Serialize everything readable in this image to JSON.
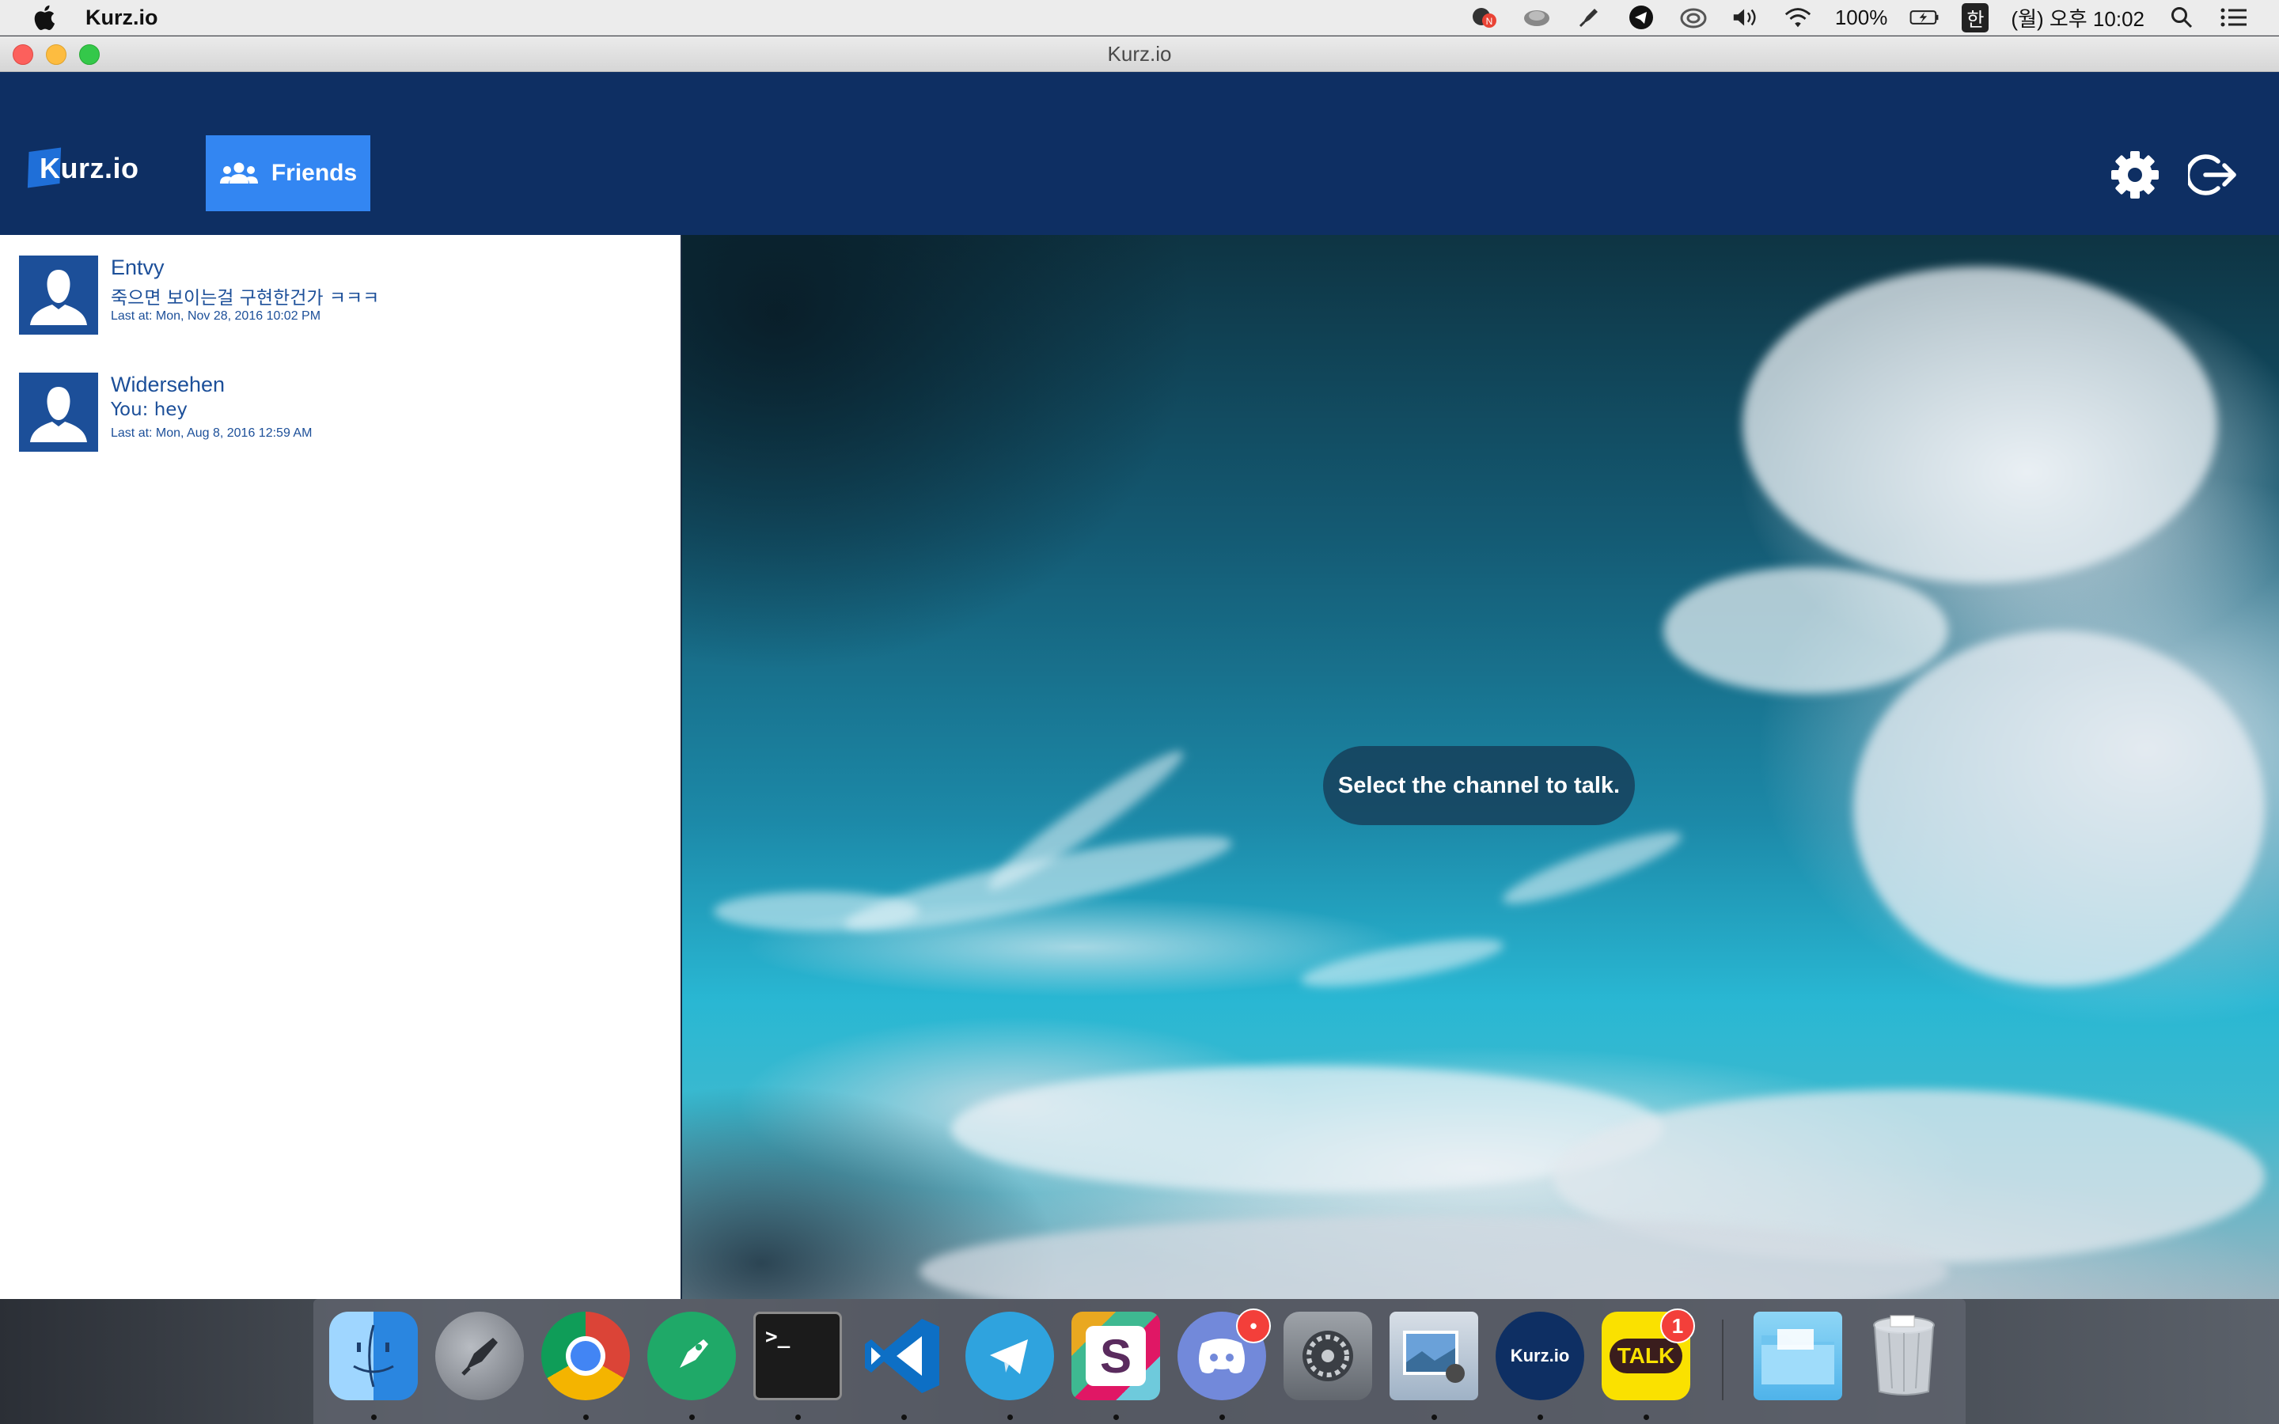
{
  "menubar": {
    "app_name": "Kurz.io",
    "battery": "100%",
    "input_lang": "한",
    "datetime": "(월) 오후 10:02",
    "icons": [
      "apple-icon",
      "notification-badge-icon",
      "cloud-sync-icon",
      "rocket-icon",
      "telegram-icon",
      "creative-cloud-icon",
      "volume-icon",
      "wifi-icon",
      "battery-icon",
      "input-source-icon",
      "spotlight-icon",
      "notification-center-icon"
    ]
  },
  "window": {
    "title": "Kurz.io"
  },
  "header": {
    "logo_text": "Kurz.io",
    "friends_label": "Friends",
    "colors": {
      "header_bg": "#0e2f63",
      "tab_active": "#3386f2"
    }
  },
  "channels": [
    {
      "name": "Entvy",
      "last_message": "죽으면 보이는걸 구현한건가 ㅋㅋㅋ",
      "last_at": "Last at: Mon, Nov 28, 2016 10:02 PM"
    },
    {
      "name": "Widersehen",
      "last_message": "You: hey",
      "last_at": "Last at: Mon, Aug 8, 2016 12:59 AM"
    }
  ],
  "main": {
    "prompt": "Select the channel to talk."
  },
  "dock": {
    "items": [
      {
        "name": "finder-icon",
        "running": true
      },
      {
        "name": "launchpad-icon",
        "running": false
      },
      {
        "name": "chrome-icon",
        "running": true
      },
      {
        "name": "gitkraken-icon",
        "running": true
      },
      {
        "name": "terminal-icon",
        "running": true,
        "label": ">_"
      },
      {
        "name": "vscode-icon",
        "running": true
      },
      {
        "name": "telegram-icon",
        "running": true
      },
      {
        "name": "slack-icon",
        "running": true,
        "label": "S"
      },
      {
        "name": "discord-icon",
        "running": true,
        "badge": "•"
      },
      {
        "name": "system-preferences-icon",
        "running": false
      },
      {
        "name": "preview-icon",
        "running": true
      },
      {
        "name": "kurzio-icon",
        "running": true,
        "label": "Kurz.io"
      },
      {
        "name": "kakaotalk-icon",
        "running": true,
        "label": "TALK",
        "badge": "1"
      },
      {
        "name": "folder-icon",
        "running": false
      },
      {
        "name": "trash-icon",
        "running": false
      }
    ]
  }
}
